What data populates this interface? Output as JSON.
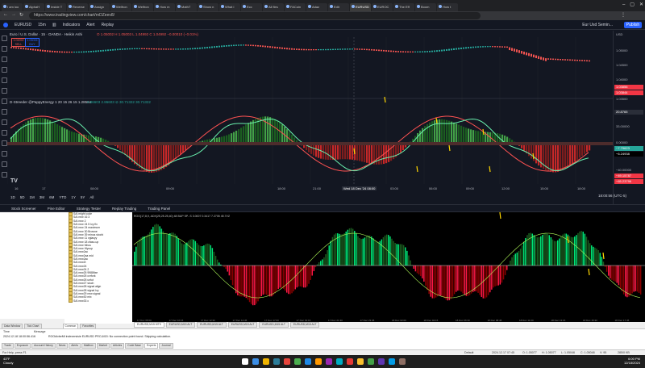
{
  "browser": {
    "tabs": [
      "I am loo",
      "AlphaH",
      "Inside T",
      "Reverse",
      "Assign",
      "Welfron",
      "Welfron",
      "How m",
      "MathT",
      "Show n",
      "What i",
      "Ecc",
      "All fles",
      "FACoin",
      "Adaz",
      "Edit",
      "EURUSD",
      "EUROC",
      "The Eff",
      "Boom",
      "How t"
    ],
    "active_tab_index": 16,
    "url": "https://www.tradingview.com/chart/rnDZeev8/"
  },
  "tv": {
    "symbol": "EURUSD",
    "interval": "15m",
    "toolbar": [
      "Indicators",
      "Alert",
      "Replay"
    ],
    "layout_name": "Eur Usd Semin...",
    "publish": "Publish",
    "currency": "USD",
    "title_legend": "Euro / U.S. Dollar · 15 · OANDA · Heikin Ashi",
    "ohlc": "O 1.05002  H 1.05003  L 1.04992  C 1.04992  −0.00010 (−0.01%)",
    "sell_price": "1.04992",
    "sell_label": "SELL",
    "buy_price": "1.05006",
    "buy_label": "BUY",
    "spread": "1.4",
    "indicator_legend": "D-Streeder @PappyEnergy 1 20 15 26 15  1.28584",
    "indicator_vals": "2.86603  2.86603  ⊘ 30.71322  30.71322",
    "price_axis": [
      "1.05000",
      "1.04500",
      "1.04000",
      "1.03500"
    ],
    "current_price": "1.03856",
    "price_tag_2": "1.03844",
    "osc_axis": [
      "20.8765",
      "33.00000",
      "0.00000",
      "−40.00000"
    ],
    "osc_tags": [
      "−7.79623",
      "−6.24938",
      "−49.15787",
      "−65.23796"
    ],
    "times": [
      "16",
      "17",
      "08:00",
      "09:00",
      "18:00",
      "21:00",
      "Wed 18 Dec '24  08:00",
      "03:00",
      "06:00",
      "09:00",
      "12:00",
      "15:00",
      "18:00"
    ],
    "ranges": [
      "1D",
      "5D",
      "1M",
      "3M",
      "6M",
      "YTD",
      "1Y",
      "5Y",
      "All"
    ],
    "clock": "18:00:56 (UTC-5)",
    "bottom_tabs": [
      "Stock Screener",
      "Pine Editor",
      "Strategy Tester",
      "Replay Trading",
      "Trading Panel"
    ]
  },
  "mt": {
    "navigator_tabs": [
      "Common",
      "Favorites"
    ],
    "tree_items": [
      "SAI might code",
      "SAI new 16 3",
      "SAI new 2",
      "SAI new 24 5 Ivy fix",
      "SAI new 24 maximum",
      "SAI new 30 Browne",
      "SAI new 39 minus stochi",
      "SAI new 11 vglasyy",
      "SAI new 18 cfaso-up",
      "SAI new hthus",
      "SAI new Hlycup",
      "SAI new2ac",
      "SAI new2aa mid",
      "SAI new2ac",
      "SAI new2t",
      "SAI new24",
      "SAI new24 2",
      "SAI new25 9988fixe",
      "SAI new25 cvrfork",
      "SAI new25 unfut",
      "SAI new27 stoch",
      "SAI new28 signal align",
      "SAI new28 signal Ivy",
      "SAI new29 new signal",
      "SAI new30 mix",
      "SAI new33 c"
    ],
    "legend": "ROO(17,8,9,  ADX(25,25.25,40) 48 BUP   SP- S  3.0007  0.3417  7.2705  45.7VZ",
    "chart_tabs": [
      "EURUSD,M15 MT5",
      "EURUSD,M15 ALT",
      "EURUSD,M15 ALT",
      "EURUSD,M15 ALT",
      "EURUSD,M15 ALT",
      "EURUSD,M15 ALT"
    ],
    "times": [
      "17 Dec 08:00",
      "17 Dec 10:15",
      "17 Dec 12:30",
      "17 Dec 14:45",
      "17 Dec 17:00",
      "17 Dec 19:15",
      "17 Dec 21:30",
      "17 Dec 23:45",
      "18 Dec 02:00",
      "18 Dec 04:15",
      "18 Dec 06:30",
      "18 Dec 08:45",
      "18 Dec 11:00",
      "18 Dec 13:15",
      "18 Dec 15:30",
      "18 Dec 17:45"
    ],
    "toolbox_headers": [
      "Time",
      "Message"
    ],
    "toolbox_message_time": "2024.12.18 18:00:56.416",
    "toolbox_message": "ROOdivbeMt indexersisie EURUSD PRO,M15: No connection point found. Skipping calculation.",
    "toolbox_tabs": [
      "Trade",
      "Exposure",
      "Account History",
      "News",
      "Alerts",
      "Mailbox",
      "Market",
      "Articles",
      "Code Base",
      "Experts",
      "Journal"
    ],
    "status_left": "For Help, press F1",
    "status_mid": "Default",
    "status_time": "2024.12.17 07:45",
    "status_vals": [
      "O: 1.05077",
      "H: 1.05077",
      "L: 1.05046",
      "C: 1.05048",
      "V: 95"
    ],
    "status_right": "285/0 KB",
    "left_tabs": [
      "Data Window",
      "Tick Chart"
    ]
  },
  "taskbar": {
    "weather_temp": "43°F",
    "weather_desc": "Cloudy",
    "time": "6:00 PM",
    "date": "12/18/2024"
  }
}
